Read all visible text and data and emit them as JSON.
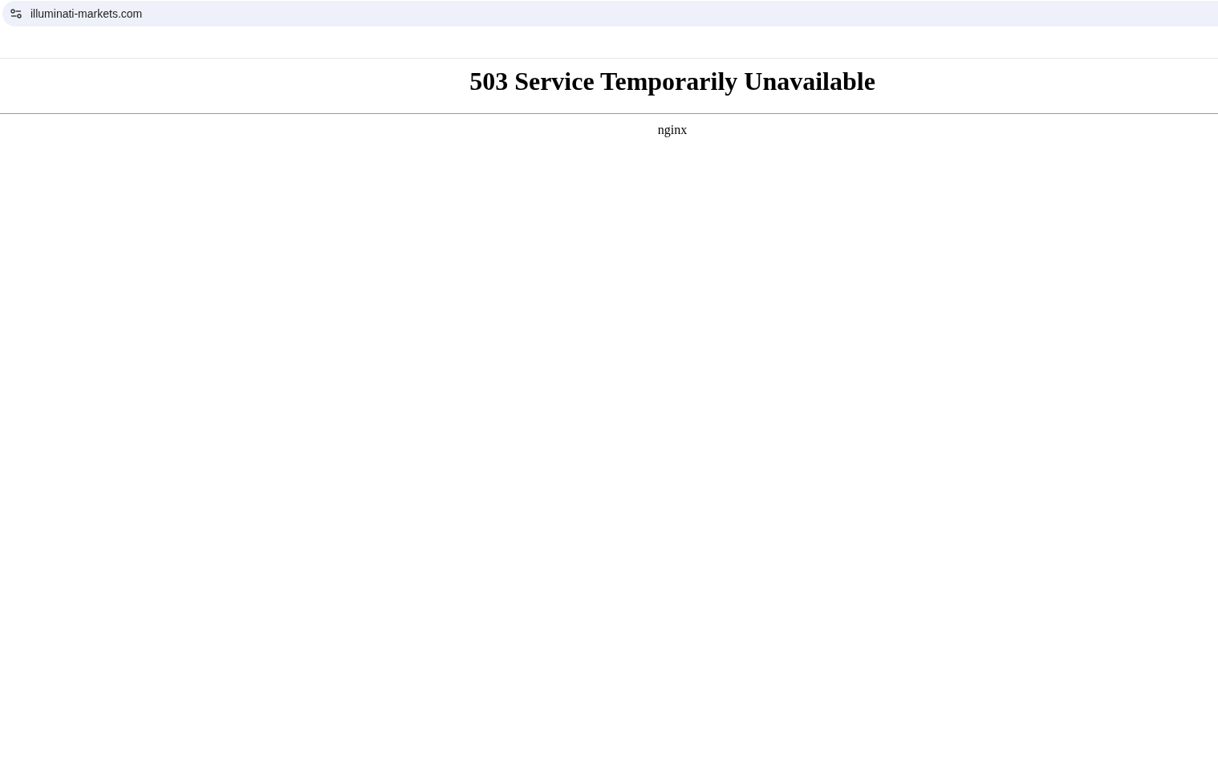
{
  "address_bar": {
    "url": "illuminati-markets.com"
  },
  "page": {
    "heading": "503 Service Temporarily Unavailable",
    "server": "nginx"
  }
}
